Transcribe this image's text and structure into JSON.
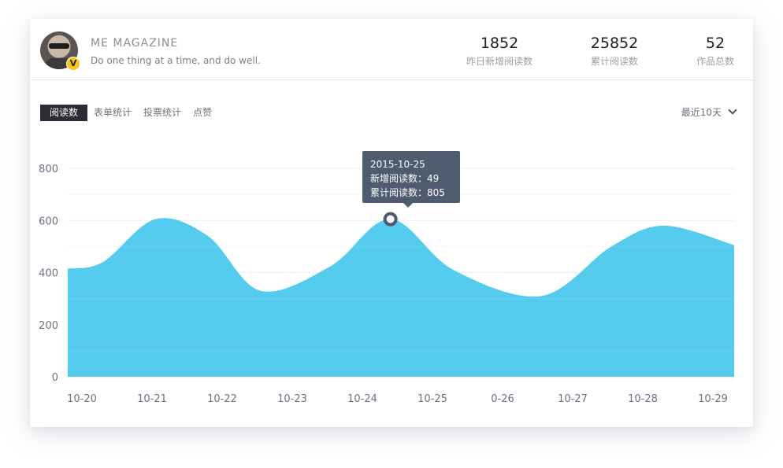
{
  "profile": {
    "brand": "ME  MAGAZINE",
    "tagline": "Do one thing at a time, and do well.",
    "badge": "V"
  },
  "stats": [
    {
      "value": "1852",
      "label": "昨日新增阅读数"
    },
    {
      "value": "25852",
      "label": "累计阅读数"
    },
    {
      "value": "52",
      "label": "作品总数"
    }
  ],
  "tabs": [
    "阅读数",
    "表单统计",
    "投票统计",
    "点赞"
  ],
  "range_label": "最近10天",
  "tooltip": {
    "date": "2015-10-25",
    "line1": "新增阅读数：49",
    "line2": "累计阅读数：805"
  },
  "colors": {
    "area": "#55cbed",
    "accent": "#2a2c33",
    "tooltip": "#4f5b6e"
  },
  "chart_data": {
    "type": "area",
    "categories": [
      "10-20",
      "10-21",
      "10-22",
      "10-23",
      "10-24",
      "10-25",
      "0-26",
      "10-27",
      "10-28",
      "10-29"
    ],
    "x": [
      0,
      0.5,
      1.25,
      2,
      2.75,
      3.75,
      4.6,
      5.5,
      6.75,
      7.75,
      8.5,
      9.5
    ],
    "y": [
      415,
      440,
      605,
      540,
      330,
      425,
      605,
      410,
      310,
      500,
      580,
      505
    ],
    "yticks": [
      0,
      200,
      400,
      600,
      800
    ],
    "ylim": [
      0,
      800
    ],
    "highlight": {
      "x": 4.6,
      "y": 605
    },
    "grid": true
  }
}
